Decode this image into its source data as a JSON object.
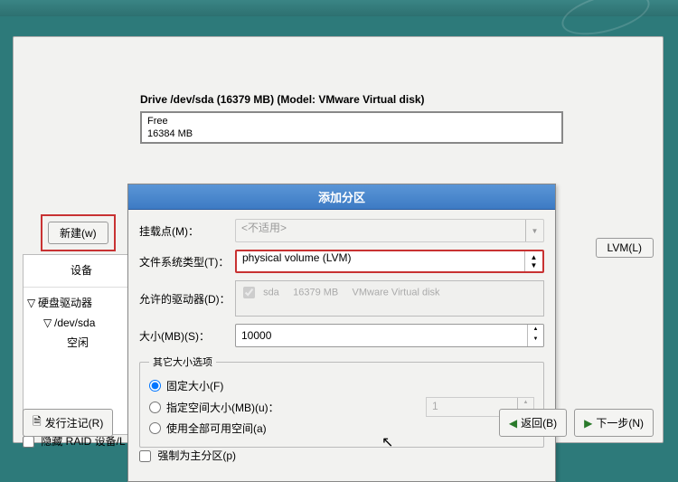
{
  "drive": {
    "title": "Drive /dev/sda (16379 MB) (Model: VMware Virtual disk)",
    "free_label": "Free",
    "free_size": "16384 MB"
  },
  "buttons": {
    "new": "新建(w)",
    "lvm": "LVM(L)",
    "release_notes": "发行注记(R)",
    "back": "返回(B)",
    "next": "下一步(N)"
  },
  "tree": {
    "header": "设备",
    "root": "硬盘驱动器",
    "dev": "/dev/sda",
    "free": "空闲"
  },
  "hide_raid": "隐藏 RAID 设备/L",
  "dialog": {
    "title": "添加分区",
    "mount_label": "挂载点(M)：",
    "mount_value": "<不适用>",
    "fs_label": "文件系统类型(T)：",
    "fs_value": "physical volume (LVM)",
    "drives_label": "允许的驱动器(D)：",
    "drives_check": "sda",
    "drives_size": "16379 MB",
    "drives_model": "VMware Virtual disk",
    "size_label": "大小(MB)(S)：",
    "size_value": "10000",
    "section": "其它大小选项",
    "opt_fixed": "固定大小(F)",
    "opt_upto": "指定空间大小(MB)(u)：",
    "opt_upto_val": "1",
    "opt_all": "使用全部可用空间(a)",
    "force_primary": "强制为主分区(p)"
  }
}
